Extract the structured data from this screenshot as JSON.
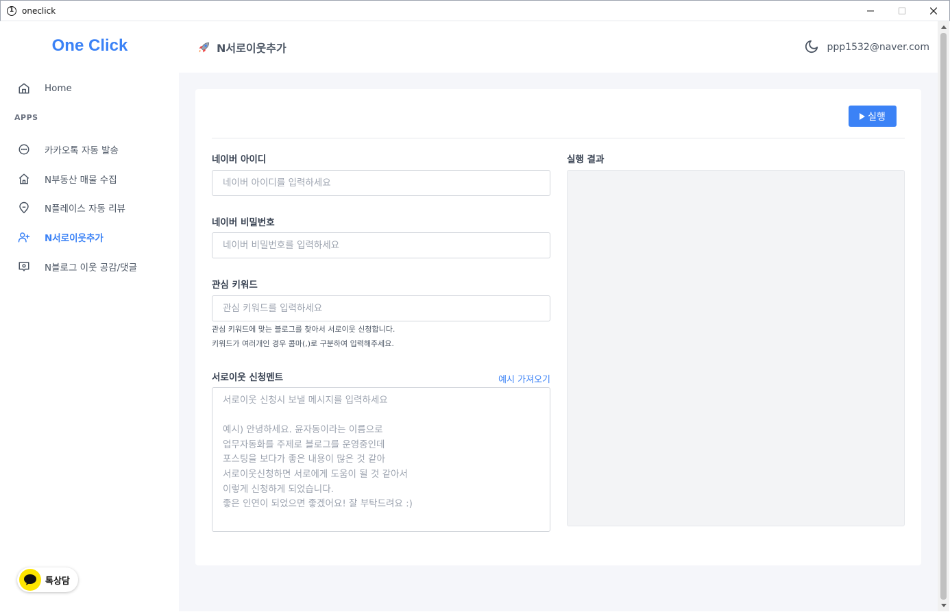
{
  "window": {
    "title": "oneclick"
  },
  "sidebar": {
    "logo": "One Click",
    "home_label": "Home",
    "section_label": "APPS",
    "items": [
      {
        "label": "카카오톡 자동 발송",
        "icon": "chat-bubble-icon"
      },
      {
        "label": "N부동산 매물 수집",
        "icon": "house-icon"
      },
      {
        "label": "N플레이스 자동 리뷰",
        "icon": "map-pin-icon"
      },
      {
        "label": "N서로이웃추가",
        "icon": "user-plus-icon",
        "active": true
      },
      {
        "label": "N블로그 이웃 공감/댓글",
        "icon": "message-square-icon"
      }
    ],
    "talk_label": "톡상담"
  },
  "header": {
    "title": "N서로이웃추가",
    "user_email": "ppp1532@naver.com"
  },
  "form": {
    "run_label": "실행",
    "naver_id": {
      "label": "네이버 아이디",
      "placeholder": "네이버 아이디를 입력하세요",
      "value": ""
    },
    "naver_pw": {
      "label": "네이버 비밀번호",
      "placeholder": "네이버 비밀번호를 입력하세요",
      "value": ""
    },
    "keyword": {
      "label": "관심 키워드",
      "placeholder": "관심 키워드를 입력하세요",
      "value": "",
      "help_1": "관심 키워드에 맞는 블로그를 찾아서 서로이웃 신청합니다.",
      "help_2": "키워드가 여러개인 경우 콤마(,)로 구분하여 입력해주세요."
    },
    "message": {
      "label": "서로이웃 신청멘트",
      "example_link": "예시 가져오기",
      "placeholder": "서로이웃 신청시 보낼 메시지를 입력하세요\n\n예시) 안녕하세요. 윤자동이라는 이름으로\n업무자동화를 주제로 블로그를 운영중인데\n포스팅을 보다가 좋은 내용이 많은 것 같아\n서로이웃신청하면 서로에게 도움이 될 것 같아서\n이렇게 신청하게 되었습니다.\n좋은 인연이 되었으면 좋겠어요! 잘 부탁드려요 :)"
    },
    "result": {
      "label": "실행 결과",
      "value": ""
    }
  },
  "colors": {
    "accent": "#3b82f6",
    "kakao": "#fee500"
  }
}
